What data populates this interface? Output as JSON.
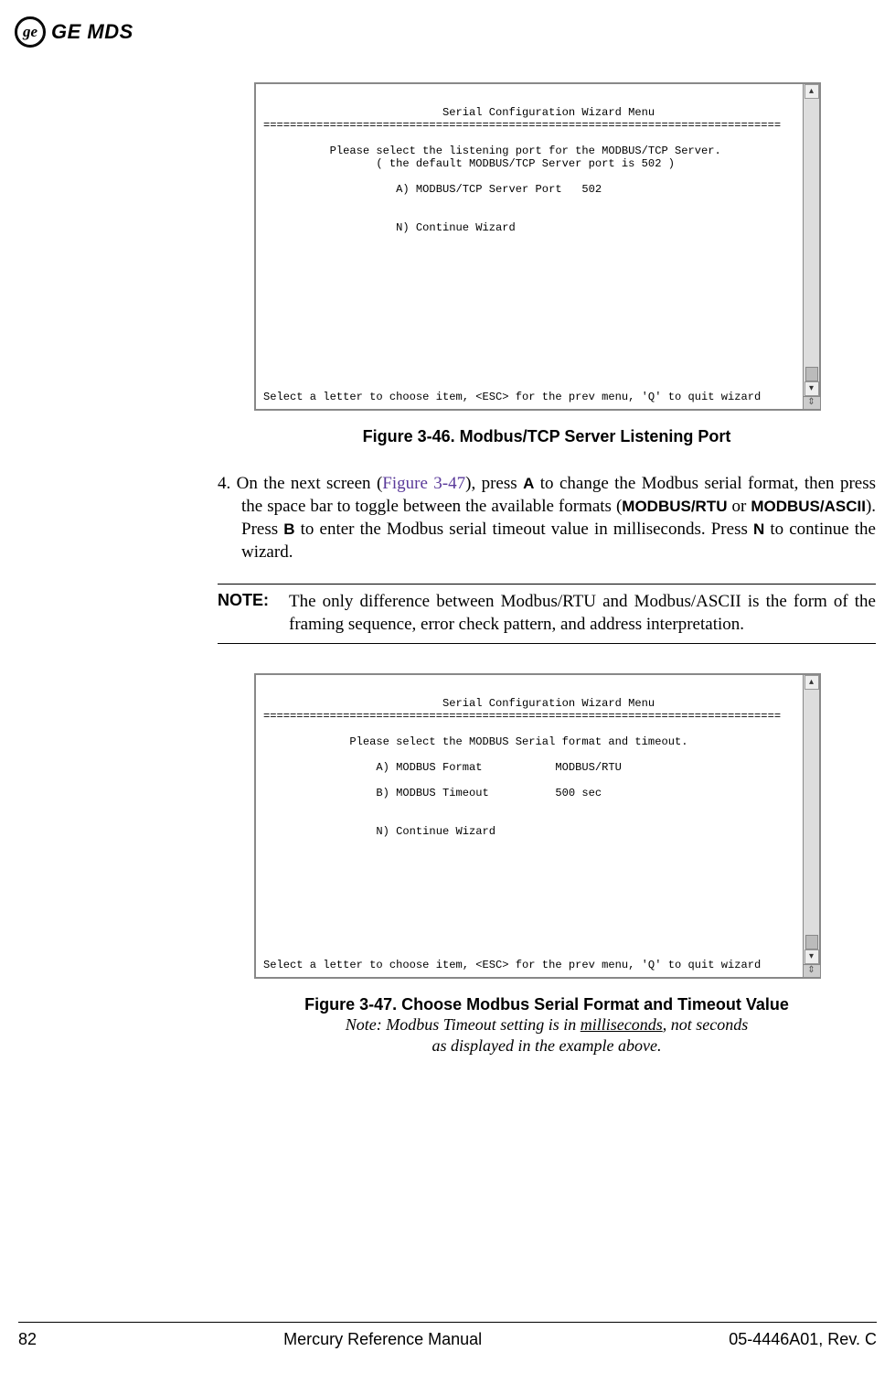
{
  "header": {
    "logo_text": "GE MDS"
  },
  "terminal1": {
    "title_line": "                           Serial Configuration Wizard Menu",
    "divider": "==============================================================================",
    "line1": "          Please select the listening port for the MODBUS/TCP Server.",
    "line2": "                 ( the default MODBUS/TCP Server port is 502 )",
    "optA": "                    A) MODBUS/TCP Server Port   502",
    "optN": "                    N) Continue Wizard",
    "footer": "Select a letter to choose item, <ESC> for the prev menu, 'Q' to quit wizard"
  },
  "caption1": "Figure 3-46. Modbus/TCP Server Listening Port",
  "step4": {
    "num": "4.  ",
    "part1": "On the next screen (",
    "link": "Figure 3-47",
    "part2": "), press ",
    "keyA": "A",
    "part3": " to change the Modbus serial format, then press the space bar to toggle between the available formats (",
    "fmt1": "MODBUS/RTU",
    "part4": " or ",
    "fmt2": "MODBUS/ASCII",
    "part5": "). Press ",
    "keyB": "B",
    "part6": " to enter the Modbus serial timeout value in milliseconds. Press ",
    "keyN": "N",
    "part7": " to continue the wizard."
  },
  "note": {
    "label": "NOTE:",
    "text": "The only difference between Modbus/RTU and Modbus/ASCII is the form of the framing sequence, error check pattern, and address interpretation."
  },
  "terminal2": {
    "title_line": "                           Serial Configuration Wizard Menu",
    "divider": "==============================================================================",
    "line1": "             Please select the MODBUS Serial format and timeout.",
    "optA": "                 A) MODBUS Format           MODBUS/RTU",
    "optB": "                 B) MODBUS Timeout          500 sec",
    "optN": "                 N) Continue Wizard",
    "footer": "Select a letter to choose item, <ESC> for the prev menu, 'Q' to quit wizard"
  },
  "caption2": {
    "title": "Figure 3-47. Choose Modbus Serial Format and Timeout Value",
    "sub1a": "Note: Modbus Timeout setting is in ",
    "sub1u": "milliseconds",
    "sub1b": ", not seconds",
    "sub2": "as displayed in the example above."
  },
  "footer": {
    "page": "82",
    "center": "Mercury Reference Manual",
    "right": "05-4446A01, Rev. C"
  }
}
